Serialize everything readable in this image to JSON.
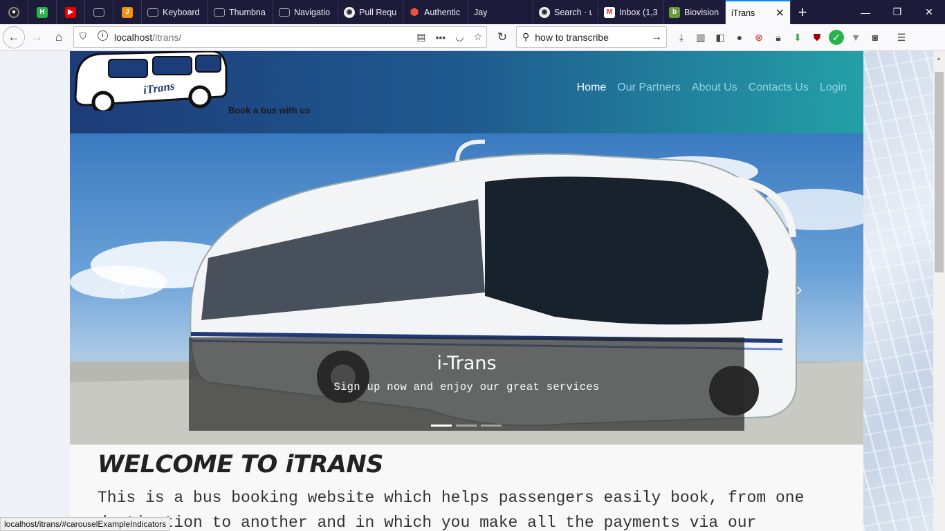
{
  "browser": {
    "tabs": [
      {
        "label": "",
        "icon": "record-icon",
        "color": "#444"
      },
      {
        "label": "",
        "icon": "h-extension-icon",
        "color": "#2bb24c"
      },
      {
        "label": "",
        "icon": "youtube-icon",
        "color": "#e00"
      },
      {
        "label": "",
        "icon": "monitor-icon",
        "color": "#777"
      },
      {
        "label": "",
        "icon": "j-icon",
        "color": "#f29111"
      },
      {
        "label": "Keyboard",
        "icon": "monitor-icon",
        "color": "#777"
      },
      {
        "label": "Thumbna",
        "icon": "monitor-icon",
        "color": "#777"
      },
      {
        "label": "Navigatio",
        "icon": "monitor-icon",
        "color": "#777"
      },
      {
        "label": "Pull Requ",
        "icon": "github-icon",
        "color": "#222"
      },
      {
        "label": "Authentic",
        "icon": "laravel-icon",
        "color": "#f0503c"
      },
      {
        "label": "Jay",
        "icon": "",
        "color": ""
      },
      {
        "label": "Search · u",
        "icon": "github-icon",
        "color": "#222"
      },
      {
        "label": "Inbox (1,3",
        "icon": "gmail-icon",
        "color": "#d93025"
      },
      {
        "label": "Biovision",
        "icon": "biovision-icon",
        "color": "#6a9a3c"
      }
    ],
    "active_tab": {
      "label": "iTrans",
      "close": "✕"
    },
    "new_tab": "+",
    "window_controls": {
      "minimize": "—",
      "restore": "❐",
      "close": "✕"
    },
    "url": {
      "host": "localhost",
      "path": "/itrans/"
    },
    "search": {
      "value": "how to transcribe"
    },
    "status_url": "localhost/itrans/#carouselExampleIndicators"
  },
  "site": {
    "logo_text": "iTrans",
    "tagline": "Book a bus with us",
    "nav": [
      "Home",
      "Our Partners",
      "About Us",
      "Contacts Us",
      "Login"
    ],
    "carousel": {
      "title": "i-Trans",
      "subtitle": "Sign up now and enjoy our great services",
      "prev": "‹",
      "next": "›",
      "active_index": 0,
      "indicator_count": 3
    },
    "welcome": "WELCOME TO iTRANS",
    "intro": "This is a bus booking website which helps passengers easily book, from one destination to another and in which you make all the payments via our"
  },
  "colors": {
    "header_start": "#1d3c7a",
    "header_end": "#23a0a6",
    "nav_active": "#ffffff",
    "nav_link": "#8fd3e6"
  }
}
